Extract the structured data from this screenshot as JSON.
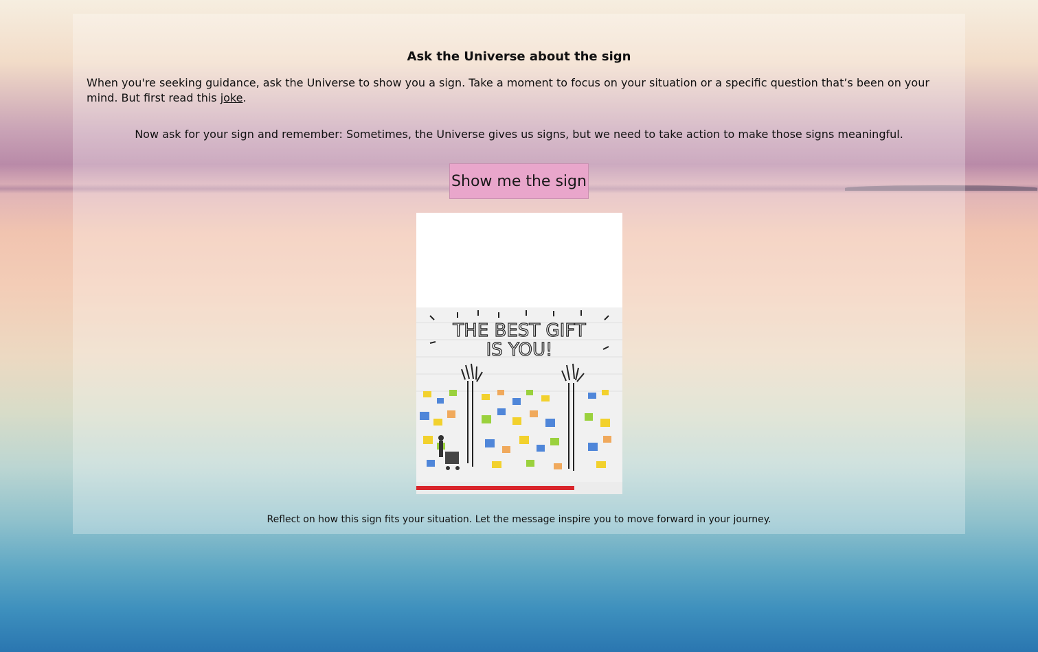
{
  "page": {
    "title": "Ask the Universe about the sign",
    "intro_text": "When you're seeking guidance, ask the Universe to show you a sign. Take a moment to focus on your situation or a specific question that’s been on your mind. But first read this ",
    "intro_link": "joke",
    "intro_end": ".",
    "reminder": "Now ask for your sign and remember: Sometimes, the Universe gives us signs, but we need to take action to make those signs meaningful.",
    "button_label": "Show me the sign",
    "reflect_text": "Reflect on how this sign fits your situation. Let the message inspire you to move forward in your journey."
  },
  "sign_image": {
    "line1": "THE BEST GIFT",
    "line2": "IS YOU!"
  },
  "colors": {
    "button": "#e9a6cb",
    "panel": "rgba(255,255,255,0.28)"
  }
}
